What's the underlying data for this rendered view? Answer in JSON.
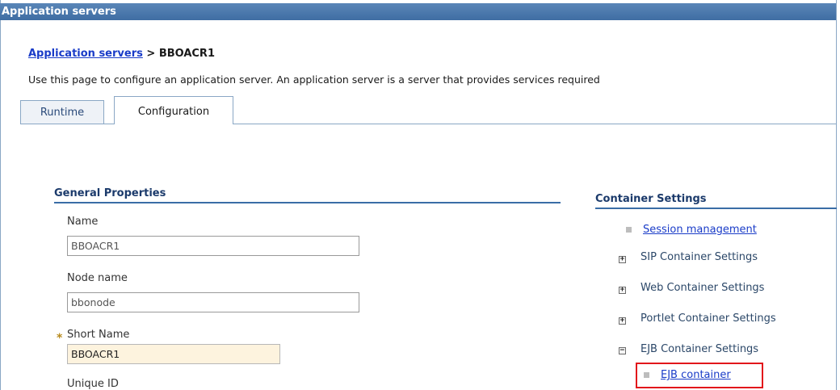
{
  "window": {
    "title": "Application servers"
  },
  "breadcrumb": {
    "parent": "Application servers",
    "separator": " > ",
    "current": "BBOACR1"
  },
  "description": "Use this page to configure an application server. An application server is a server that provides services required",
  "tabs": [
    {
      "label": "Runtime",
      "active": false
    },
    {
      "label": "Configuration",
      "active": true
    }
  ],
  "general_properties": {
    "title": "General Properties",
    "fields": [
      {
        "label": "Name",
        "value": "BBOACR1",
        "required": false
      },
      {
        "label": "Node name",
        "value": "bbonode",
        "required": false
      },
      {
        "label": "Short Name",
        "value": "BBOACR1",
        "required": true,
        "required_marker": "*"
      },
      {
        "label": "Unique ID"
      }
    ]
  },
  "container_settings": {
    "title": "Container Settings",
    "session_management": "Session management",
    "groups": [
      {
        "label": "SIP Container Settings",
        "expander": "+"
      },
      {
        "label": "Web Container Settings",
        "expander": "+"
      },
      {
        "label": "Portlet Container Settings",
        "expander": "+"
      },
      {
        "label": "EJB Container Settings",
        "expander": "−"
      }
    ],
    "ejb_container_link": "EJB container"
  },
  "colors": {
    "title_bar": "#3f6da3",
    "link": "#1a3cc8",
    "highlight_box": "#e2161b",
    "required_field_bg": "#fdf3de"
  }
}
